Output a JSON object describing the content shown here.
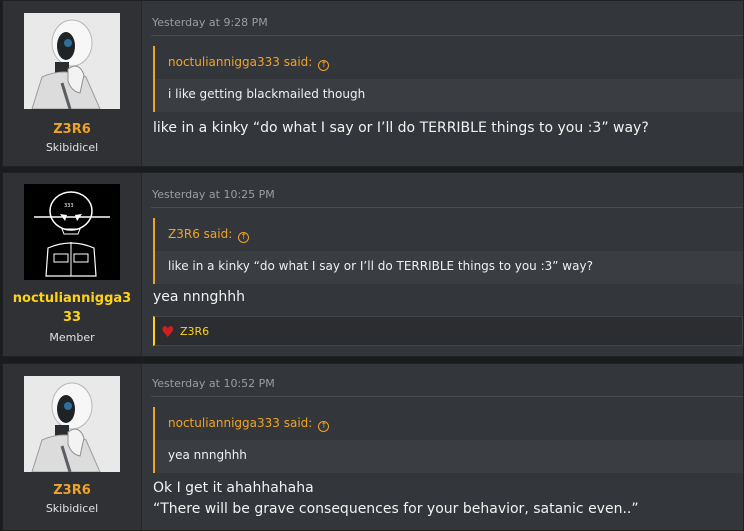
{
  "posts": [
    {
      "author": "Z3R6",
      "user_title": "Skibidicel",
      "avatar": "robot-avatar",
      "timestamp": "Yesterday at 9:28 PM",
      "quote": {
        "attribution": "noctuliannigga333 said:",
        "text": "i like getting blackmailed though"
      },
      "message": [
        "like in a kinky “do what I say or I’ll do TERRIBLE things to you :3” way?"
      ]
    },
    {
      "author": "noctuliannigga333",
      "author_lines": [
        "noctuliannigga3",
        "33"
      ],
      "user_title": "Member",
      "avatar": "alien-avatar",
      "timestamp": "Yesterday at 10:25 PM",
      "quote": {
        "attribution": "Z3R6 said:",
        "text": "like in a kinky “do what I say or I’ll do TERRIBLE things to you :3” way?"
      },
      "message": [
        "yea nnnghhh"
      ],
      "reaction": {
        "icon": "heart-icon",
        "user": "Z3R6"
      }
    },
    {
      "author": "Z3R6",
      "user_title": "Skibidicel",
      "avatar": "robot-avatar",
      "timestamp": "Yesterday at 10:52 PM",
      "quote": {
        "attribution": "noctuliannigga333 said:",
        "text": "yea nnnghhh"
      },
      "message": [
        "Ok I get it ahahhahaha",
        "“There will be grave consequences for your behavior, satanic even..”"
      ]
    }
  ],
  "colors": {
    "accent": "#f0a426",
    "member_name": "#ffd21a",
    "background": "#33363a"
  }
}
